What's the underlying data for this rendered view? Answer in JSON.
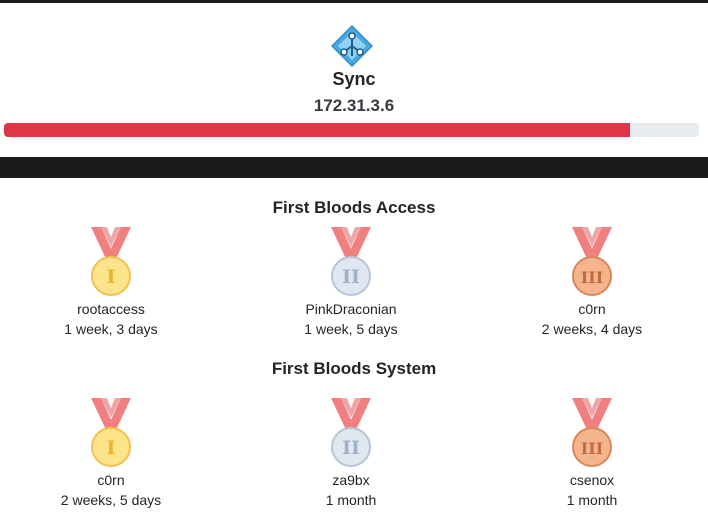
{
  "header": {
    "title": "Sync",
    "ip": "172.31.3.6",
    "progress_fraction": 0.9,
    "progress_color": "#e03546",
    "logo_icon": "diamond-network-icon"
  },
  "sections": [
    {
      "title": "First Bloods Access",
      "entries": [
        {
          "medal": "gold",
          "rank": "I",
          "user": "rootaccess",
          "time": "1 week, 3 days"
        },
        {
          "medal": "silver",
          "rank": "II",
          "user": "PinkDraconian",
          "time": "1 week, 5 days"
        },
        {
          "medal": "bronze",
          "rank": "III",
          "user": "c0rn",
          "time": "2 weeks, 4 days"
        }
      ]
    },
    {
      "title": "First Bloods System",
      "entries": [
        {
          "medal": "gold",
          "rank": "I",
          "user": "c0rn",
          "time": "2 weeks, 5 days"
        },
        {
          "medal": "silver",
          "rank": "II",
          "user": "za9bx",
          "time": "1 month"
        },
        {
          "medal": "bronze",
          "rank": "III",
          "user": "csenox",
          "time": "1 month"
        }
      ]
    }
  ],
  "colors": {
    "ribbon": "#f07f7f",
    "gold_fill": "#fde38a",
    "gold_stroke": "#f2c14e",
    "gold_text": "#e9b52c",
    "silver_fill": "#dfe7f1",
    "silver_stroke": "#b7c5d6",
    "silver_text": "#9fb1c6",
    "bronze_fill": "#f4b58c",
    "bronze_stroke": "#d9875a",
    "bronze_text": "#c06c3f"
  }
}
